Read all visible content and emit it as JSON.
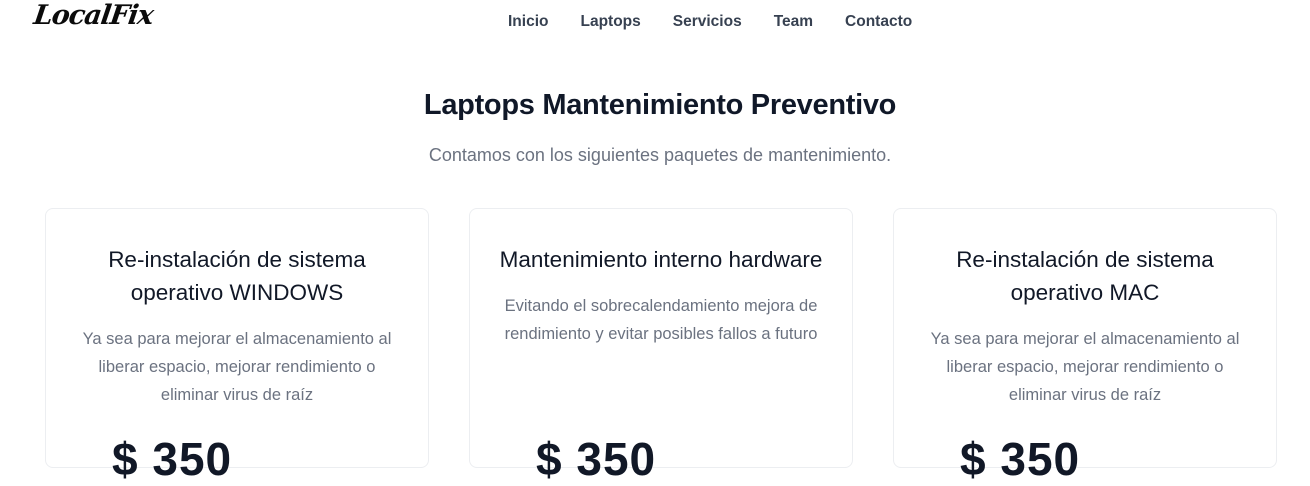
{
  "brand": {
    "logo_text": "LocalFix"
  },
  "nav": {
    "items": [
      {
        "label": "Inicio"
      },
      {
        "label": "Laptops"
      },
      {
        "label": "Servicios"
      },
      {
        "label": "Team"
      },
      {
        "label": "Contacto"
      }
    ]
  },
  "hero": {
    "title": "Laptops Mantenimiento Preventivo",
    "subtitle": "Contamos con los siguientes paquetes de mantenimiento."
  },
  "cards": [
    {
      "title": "Re-instalación de sistema operativo WINDOWS",
      "description": "Ya sea para mejorar el almacenamiento al liberar espacio, mejorar rendimiento o eliminar virus de raíz",
      "price": "$ 350"
    },
    {
      "title": "Mantenimiento interno hardware",
      "description": "Evitando el sobrecalendamiento mejora de rendimiento y evitar posibles fallos a futuro",
      "price": "$ 350"
    },
    {
      "title": "Re-instalación de sistema operativo MAC",
      "description": "Ya sea para mejorar el almacenamiento al liberar espacio, mejorar rendimiento o eliminar virus de raíz",
      "price": "$ 350"
    }
  ]
}
